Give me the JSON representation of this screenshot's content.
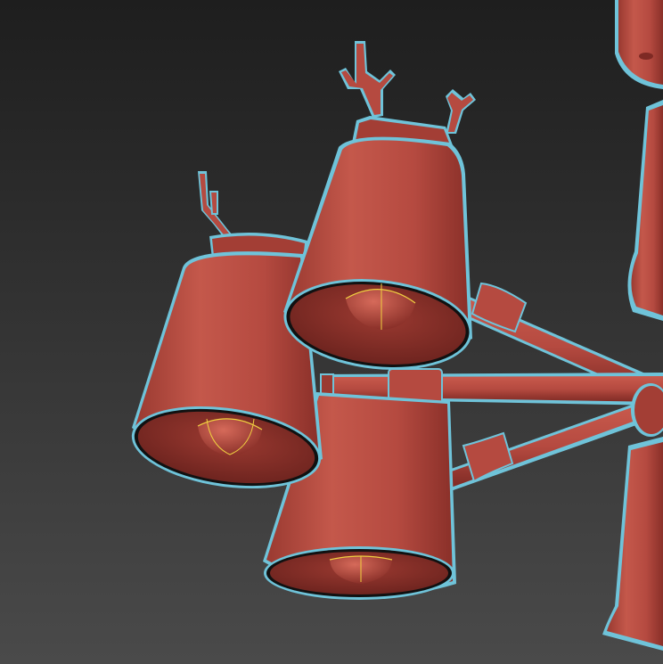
{
  "scene": {
    "object_color": "#b54a40",
    "object_shade": "#8f332b",
    "object_highlight": "#c95a4d",
    "inner_color": "#7e2a24",
    "selection_outline": "#6fc3d9",
    "bulb_wire_color": "#f0d040",
    "background_top": "#1e1e1e",
    "background_bottom": "#4a4a4a"
  }
}
